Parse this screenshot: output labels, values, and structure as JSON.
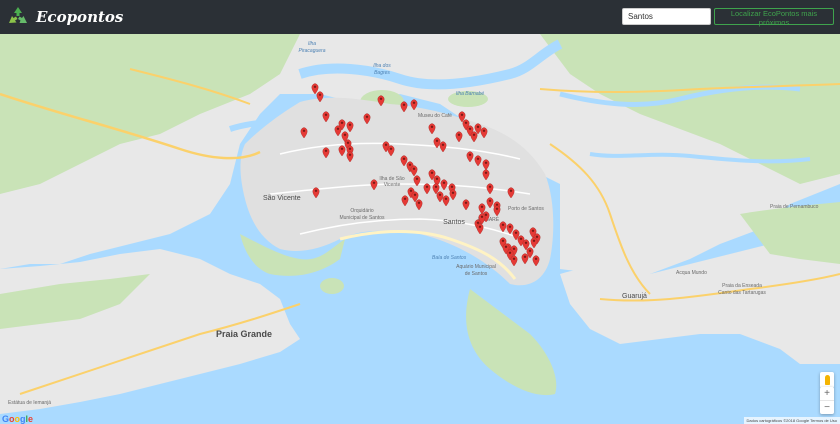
{
  "header": {
    "brand_name": "Ecopontos",
    "logo_icon": "recycle-icon",
    "search_value": "Santos",
    "locate_button_label": "Localizar EcoPontos mais próximos"
  },
  "colors": {
    "navbar": "#2b3036",
    "accent": "#3fa34d",
    "marker": "#e53935",
    "water": "#aadaff",
    "land": "#e8e8e8",
    "vegetation": "#c9e3b7",
    "road": "#fbd16b"
  },
  "map": {
    "labels": {
      "ilha_piracaguera": "Ilha",
      "ilha_piracaguera_2": "Piracaguera",
      "ilha_dos_bagres": "Ilha dos",
      "ilha_dos_bagres_2": "Bagres",
      "ilha_barnabe": "Ilha Barnabé",
      "museu_do_cafe": "Museu do Café",
      "ilha_sao_vicente": "Ilha de São",
      "ilha_sao_vicente_2": "Vicente",
      "sao_vicente": "São Vicente",
      "orquidario": "Orquidário",
      "orquidario_2": "Municipal de Santos",
      "santos": "Santos",
      "porto_de_santos": "Porto de Santos",
      "aquario": "Aquário Municipal",
      "aquario_2": "de Santos",
      "guaruja": "Guarujá",
      "acqua_mundo": "Acqua Mundo",
      "praia_pernambuco": "Praia de Pernambuco",
      "praia_grande": "Praia Grande",
      "praia_enseada": "Praia da Enseada",
      "praia_enseada_2": "Canto das Tartarugas",
      "baia_santos": "Baía de Santos",
      "estatua": "Estátua de Iemanjá",
      "embare": "EMBARÉ"
    },
    "markers_count": 80,
    "google_logo": "Google",
    "attribution": "Dados cartográficos ©2018 Google    Termos de Uso",
    "zoom_in": "+",
    "zoom_out": "−",
    "pegman_icon": "pegman-icon"
  }
}
